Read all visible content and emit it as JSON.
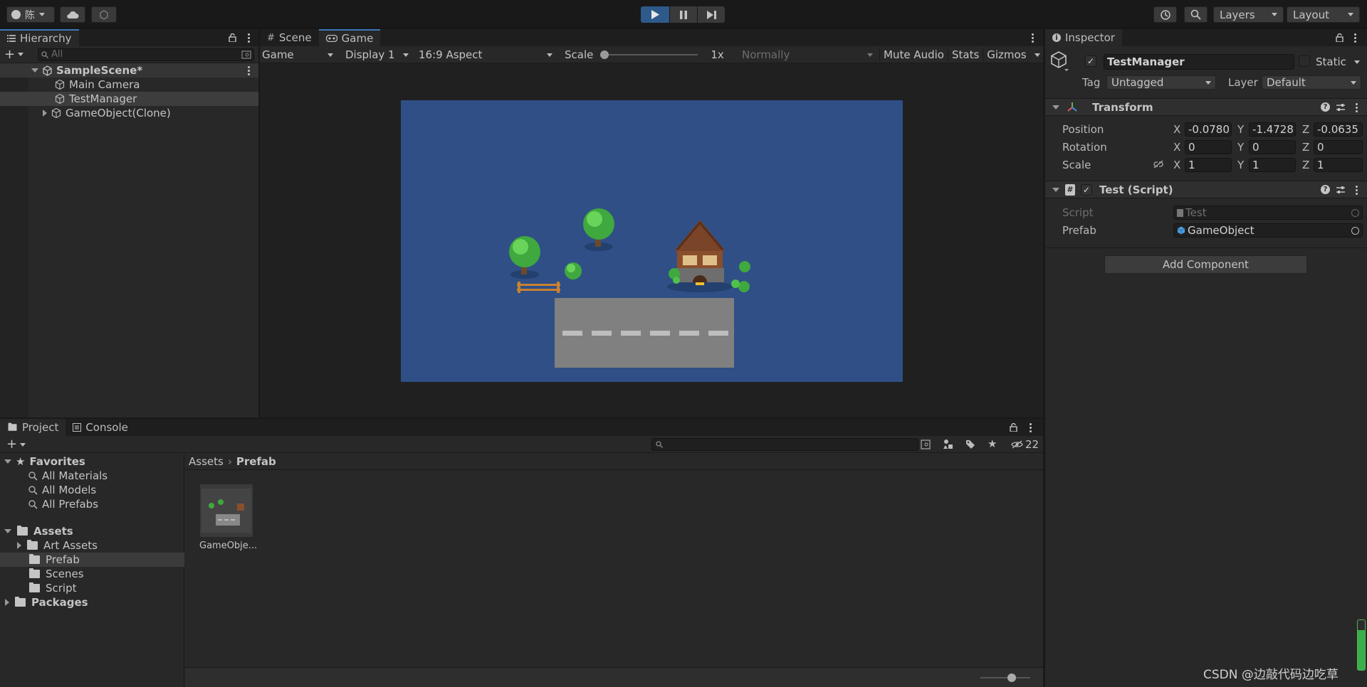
{
  "toolbar": {
    "account_label": "陈",
    "layers_label": "Layers",
    "layout_label": "Layout"
  },
  "hierarchy": {
    "tab_label": "Hierarchy",
    "search_placeholder": "All",
    "scene_name": "SampleScene*",
    "items": [
      {
        "label": "Main Camera"
      },
      {
        "label": "TestManager"
      },
      {
        "label": "GameObject(Clone)"
      }
    ]
  },
  "game_view": {
    "tabs": [
      {
        "label": "Scene"
      },
      {
        "label": "Game"
      }
    ],
    "mode_select": "Game",
    "display_select": "Display 1",
    "aspect_select": "16:9 Aspect",
    "scale_label": "Scale",
    "scale_value": "1x",
    "normally_select": "Normally",
    "mute_audio_label": "Mute Audio",
    "stats_label": "Stats",
    "gizmos_label": "Gizmos",
    "viewport_bg": "#2f4f86"
  },
  "inspector": {
    "tab_label": "Inspector",
    "object_name": "TestManager",
    "static_label": "Static",
    "tag_label": "Tag",
    "tag_value": "Untagged",
    "layer_label": "Layer",
    "layer_value": "Default",
    "transform": {
      "title": "Transform",
      "position_label": "Position",
      "rotation_label": "Rotation",
      "scale_label": "Scale",
      "x_label": "X",
      "y_label": "Y",
      "z_label": "Z",
      "position": {
        "x": "-0.0780",
        "y": "-1.4728",
        "z": "-0.0635"
      },
      "rotation": {
        "x": "0",
        "y": "0",
        "z": "0"
      },
      "scale": {
        "x": "1",
        "y": "1",
        "z": "1"
      }
    },
    "script_component": {
      "title": "Test (Script)",
      "script_label": "Script",
      "script_value": "Test",
      "prefab_label": "Prefab",
      "prefab_value": "GameObject"
    },
    "add_component_label": "Add Component"
  },
  "project": {
    "tabs": [
      {
        "label": "Project"
      },
      {
        "label": "Console"
      }
    ],
    "hidden_count": "22",
    "favorites_label": "Favorites",
    "favorites": [
      {
        "label": "All Materials"
      },
      {
        "label": "All Models"
      },
      {
        "label": "All Prefabs"
      }
    ],
    "assets_label": "Assets",
    "asset_folders": [
      {
        "label": "Art Assets"
      },
      {
        "label": "Prefab"
      },
      {
        "label": "Scenes"
      },
      {
        "label": "Script"
      }
    ],
    "packages_label": "Packages",
    "breadcrumb": {
      "root": "Assets",
      "current": "Prefab"
    },
    "files": [
      {
        "label": "GameObje..."
      }
    ]
  },
  "watermark": "CSDN @边敲代码边吃草"
}
